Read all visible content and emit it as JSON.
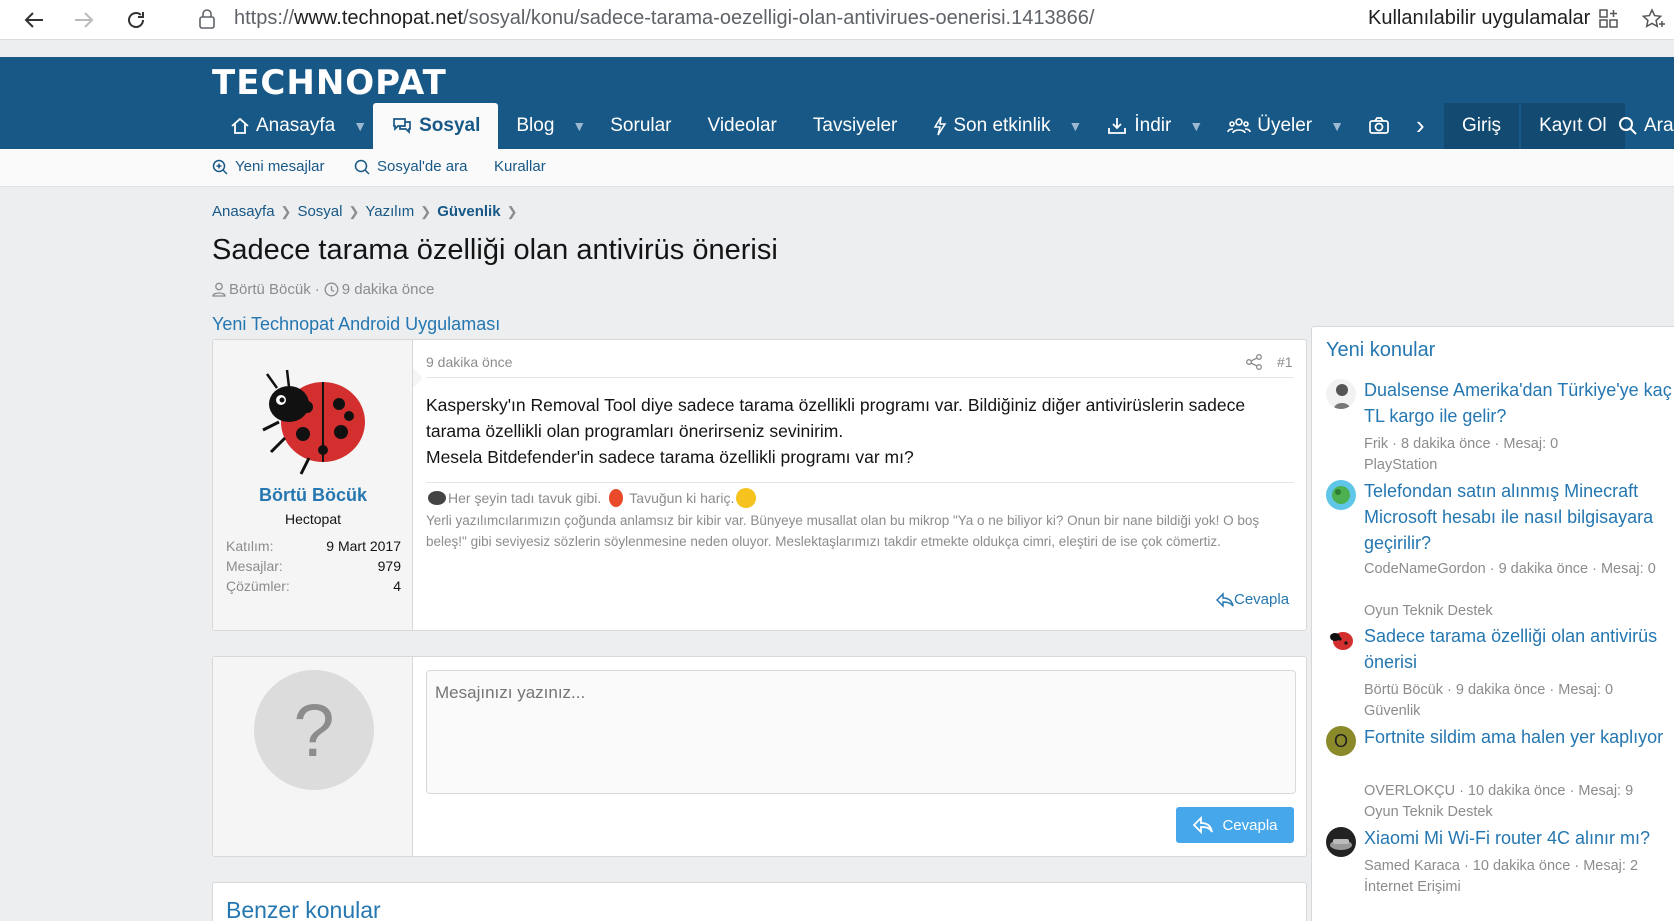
{
  "browser": {
    "url_prefix": "https://",
    "url_host": "www.technopat.net",
    "url_path": "/sosyal/konu/sadece-tarama-oezelligi-olan-antivirues-oenerisi.1413866/",
    "apps_label": "Kullanılabilir uygulamalar"
  },
  "site": {
    "logo": "TECHNOPAT",
    "nav": {
      "home": "Anasayfa",
      "sosyal": "Sosyal",
      "blog": "Blog",
      "sorular": "Sorular",
      "videolar": "Videolar",
      "tavsiyeler": "Tavsiyeler",
      "son_etkinlik": "Son etkinlik",
      "indir": "İndir",
      "uyeler": "Üyeler",
      "giris": "Giriş",
      "kayit": "Kayıt Ol",
      "ara": "Ara"
    },
    "subnav": {
      "new_posts": "Yeni mesajlar",
      "search": "Sosyal'de ara",
      "rules": "Kurallar"
    }
  },
  "breadcrumb": [
    "Anasayfa",
    "Sosyal",
    "Yazılım",
    "Güvenlik"
  ],
  "thread": {
    "title": "Sadece tarama özelliği olan antivirüs önerisi",
    "author": "Börtü Böcük",
    "time": "9 dakika önce",
    "promo": "Yeni Technopat Android Uygulaması"
  },
  "post": {
    "user": {
      "name": "Börtü Böcük",
      "title": "Hectopat",
      "joined_label": "Katılım:",
      "joined": "9 Mart 2017",
      "messages_label": "Mesajlar:",
      "messages": "979",
      "solutions_label": "Çözümler:",
      "solutions": "4"
    },
    "date": "9 dakika önce",
    "number": "#1",
    "body_1": "Kaspersky'ın Removal Tool diye sadece tarama özellikli programı var. Bildiğiniz diğer antivirüslerin sadece tarama özellikli olan programları önerirseniz sevinirim.",
    "body_2": "Mesela Bitdefender'in sadece tarama özellikli programı var mı?",
    "sig_a": "Her şeyin tadı tavuk gibi.",
    "sig_b": "Tavuğun ki hariç.",
    "sig_text": "Yerli yazılımcılarımızın çoğunda anlamsız bir kibir var. Bünyeye musallat olan bu mikrop \"Ya o ne biliyor ki? Onun bir nane bildiği yok! O boş beleş!\" gibi seviyesiz sözlerin söylenmesine neden oluyor. Meslektaşlarımızı takdir etmekte oldukça cimri, eleştiri de ise çok cömertiz.",
    "reply": "Cevapla"
  },
  "quick_reply": {
    "avatar_letter": "?",
    "placeholder": "Mesajınızı yazınız...",
    "button": "Cevapla"
  },
  "similar": {
    "title": "Benzer konular"
  },
  "sidebar": {
    "title": "Yeni konular",
    "threads": [
      {
        "title": "Dualsense Amerika'dan Türkiye'ye kaç TL kargo ile gelir?",
        "meta": "Frik · 8 dakika önce · Mesaj: 0",
        "forum": "PlayStation"
      },
      {
        "title": "Telefondan satın alınmış Minecraft Microsoft hesabı ile nasıl bilgisayara geçirilir?",
        "meta": "CodeNameGordon · 9 dakika önce · Mesaj: 0",
        "forum": "Oyun Teknik Destek"
      },
      {
        "title": "Sadece tarama özelliği olan antivirüs önerisi",
        "meta": "Börtü Böcük · 9 dakika önce · Mesaj: 0",
        "forum": "Güvenlik"
      },
      {
        "title": "Fortnite sildim ama halen yer kaplıyor",
        "meta": "OVERLOKÇU · 10 dakika önce · Mesaj: 9",
        "forum": "Oyun Teknik Destek",
        "avatar_letter": "O"
      },
      {
        "title": "Xiaomi Mi Wi-Fi router 4C alınır mı?",
        "meta": "Samed Karaca · 10 dakika önce · Mesaj: 2",
        "forum": "İnternet Erişimi"
      }
    ]
  },
  "colors": {
    "header": "#185886",
    "link": "#2577b1",
    "button": "#47a7eb"
  }
}
